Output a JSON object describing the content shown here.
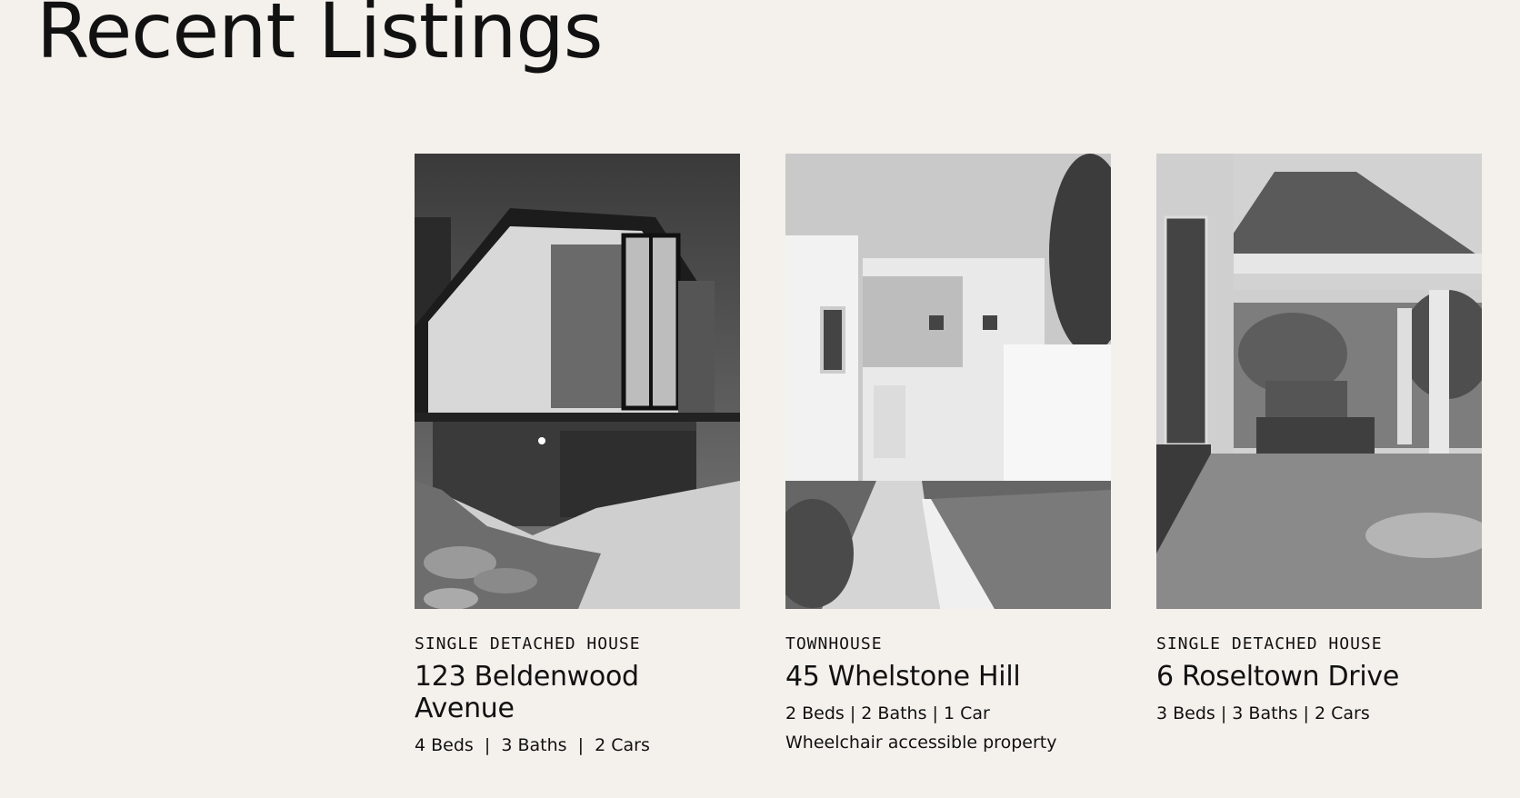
{
  "page": {
    "title": "Recent Listings"
  },
  "listings": [
    {
      "type": "SINGLE DETACHED HOUSE",
      "address": "123 Beldenwood Avenue",
      "specs": "4 Beds  |  3 Baths  |  2 Cars",
      "note": ""
    },
    {
      "type": "TOWNHOUSE",
      "address": "45 Whelstone Hill",
      "specs": "2 Beds | 2 Baths | 1 Car",
      "note": "Wheelchair accessible property"
    },
    {
      "type": "SINGLE DETACHED HOUSE",
      "address": "6 Roseltown Drive",
      "specs": "3 Beds | 3 Baths | 2 Cars",
      "note": ""
    }
  ]
}
